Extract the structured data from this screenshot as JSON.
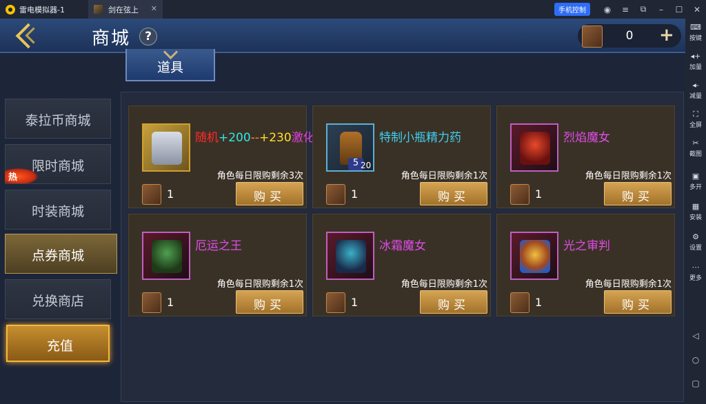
{
  "emulator": {
    "app_name": "雷电模拟器-1",
    "tab_title": "剑在弦上",
    "phone_control": "手机控制",
    "sidebar": [
      {
        "label": "按键",
        "icon": "keyboard-icon"
      },
      {
        "label": "加量",
        "icon": "volume-up-icon"
      },
      {
        "label": "减量",
        "icon": "volume-down-icon"
      },
      {
        "label": "全屏",
        "icon": "fullscreen-icon"
      },
      {
        "label": "截图",
        "icon": "scissors-icon"
      },
      {
        "label": "多开",
        "icon": "multi-instance-icon"
      },
      {
        "label": "安装",
        "icon": "apk-install-icon"
      },
      {
        "label": "设置",
        "icon": "gear-icon"
      },
      {
        "label": "更多",
        "icon": "more-icon"
      }
    ]
  },
  "header": {
    "title": "商城",
    "help": "?",
    "currency_value": "0",
    "add": "+"
  },
  "tab": {
    "label": "道具"
  },
  "menu": {
    "items": [
      {
        "label": "泰拉币商城"
      },
      {
        "label": "限时商城"
      },
      {
        "label": "时装商城"
      },
      {
        "label": "点券商城"
      },
      {
        "label": "兑换商店"
      },
      {
        "label": "充值"
      }
    ],
    "hot_badge": "热",
    "active_index": 3
  },
  "products": [
    {
      "name_parts": [
        {
          "text": "随机",
          "color": "#ff2a2a"
        },
        {
          "text": "+200",
          "color": "#2ee8e8"
        },
        {
          "text": "--",
          "color": "#ff8a2a"
        },
        {
          "text": "+230",
          "color": "#ffe02a"
        },
        {
          "text": "激化",
          "color": "#e040e0"
        }
      ],
      "limit": "角色每日限购剩余3次",
      "price": "1",
      "buy": "购买",
      "thumb_style": "gold"
    },
    {
      "name_parts": [
        {
          "text": "特制小瓶精力药",
          "color": "#3ed0f0"
        }
      ],
      "limit": "角色每日限购剩余1次",
      "price": "1",
      "buy": "购买",
      "thumb_style": "blue",
      "thumb_badge": "5",
      "thumb_count": "20"
    },
    {
      "name_parts": [
        {
          "text": "烈焰魔女",
          "color": "#e04ce8"
        }
      ],
      "limit": "角色每日限购剩余1次",
      "price": "1",
      "buy": "购买",
      "thumb_style": "purple"
    },
    {
      "name_parts": [
        {
          "text": "厄运之王",
          "color": "#e04ce8"
        }
      ],
      "limit": "角色每日限购剩余1次",
      "price": "1",
      "buy": "购买",
      "thumb_style": "purple"
    },
    {
      "name_parts": [
        {
          "text": "冰霜魔女",
          "color": "#e04ce8"
        }
      ],
      "limit": "角色每日限购剩余1次",
      "price": "1",
      "buy": "购买",
      "thumb_style": "purple"
    },
    {
      "name_parts": [
        {
          "text": "光之审判",
          "color": "#e04ce8"
        }
      ],
      "limit": "角色每日限购剩余1次",
      "price": "1",
      "buy": "购买",
      "thumb_style": "purple"
    }
  ]
}
